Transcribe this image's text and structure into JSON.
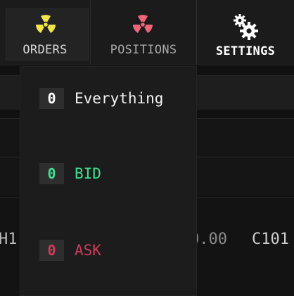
{
  "nav": {
    "orders_label": "ORDERS",
    "positions_label": "POSITIONS",
    "settings_label": "SETTINGS"
  },
  "icons": {
    "orders": "radiation-icon",
    "positions": "radiation-icon",
    "settings": "gears-icon"
  },
  "colors": {
    "orders_icon": "#f2e34c",
    "positions_icon": "#f0647a",
    "bid": "#3ee08f",
    "ask": "#cc3d5a"
  },
  "background": {
    "h_label": "H1",
    "price_tail": "0.00",
    "c_label": "C101"
  },
  "dropdown": {
    "items": [
      {
        "count": "0",
        "label": "Everything"
      },
      {
        "count": "0",
        "label": "BID"
      },
      {
        "count": "0",
        "label": "ASK"
      }
    ]
  }
}
